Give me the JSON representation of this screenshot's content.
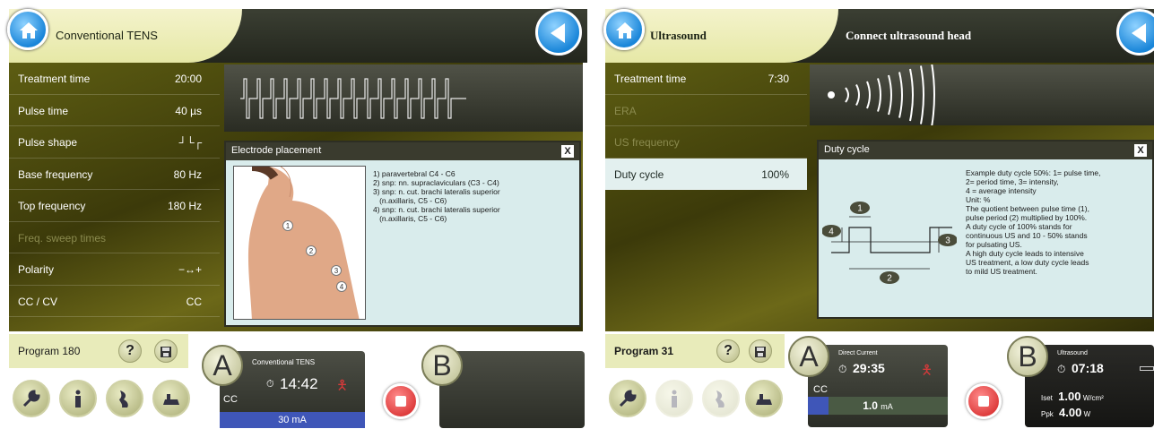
{
  "left": {
    "title": "Conventional TENS",
    "params": [
      {
        "label": "Treatment time",
        "value": "20:00",
        "state": "normal"
      },
      {
        "label": "Pulse time",
        "value": "40 µs",
        "state": "normal"
      },
      {
        "label": "Pulse shape",
        "value": "┘└┌",
        "state": "normal"
      },
      {
        "label": "Base frequency",
        "value": "80 Hz",
        "state": "normal"
      },
      {
        "label": "Top frequency",
        "value": "180 Hz",
        "state": "normal"
      },
      {
        "label": "Freq. sweep times",
        "value": "",
        "state": "dim"
      },
      {
        "label": "Polarity",
        "value": "−↔+",
        "state": "normal"
      },
      {
        "label": "CC / CV",
        "value": "CC",
        "state": "normal"
      }
    ],
    "popup": {
      "title": "Electrode placement",
      "close": "X",
      "lines": [
        "1) paravertebral C4 - C6",
        "2) snp: nn. supraclaviculars (C3 - C4)",
        "3) snp: n. cut. brachi lateralis superior",
        "   (n.axillaris, C5 - C6)",
        "4) snp: n. cut. brachi lateralis superior",
        "   (n.axillaris, C5 - C6)"
      ],
      "markers": [
        "1",
        "2",
        "3",
        "4"
      ]
    },
    "program": "Program 180",
    "help": "?",
    "channel_a": {
      "letter": "A",
      "mode": "Conventional TENS",
      "time": "14:42",
      "type": "CC",
      "intensity": "30 mA",
      "intensity_fraction": 1.0
    },
    "channel_b": {
      "letter": "B"
    }
  },
  "right": {
    "title": "Ultrasound",
    "subtitle": "Connect ultrasound head",
    "params": [
      {
        "label": "Treatment time",
        "value": "7:30",
        "state": "normal"
      },
      {
        "label": "ERA",
        "value": "",
        "state": "dim"
      },
      {
        "label": "US frequency",
        "value": "",
        "state": "dim"
      },
      {
        "label": "Duty cycle",
        "value": "100%",
        "state": "selected"
      }
    ],
    "popup": {
      "title": "Duty cycle",
      "close": "X",
      "lines": [
        "Example duty cycle 50%: 1= pulse time,",
        "2= period time, 3= intensity,",
        "4 = average intensity",
        "Unit: %",
        "The quotient between pulse time (1),",
        "pulse period (2) multiplied by 100%.",
        "A duty cycle of 100% stands for",
        "continuous US and 10 - 50% stands",
        "for pulsating US.",
        "A high duty cycle leads to intensive",
        "US treatment, a low duty cycle leads",
        "to mild US treatment."
      ],
      "markers": [
        "1",
        "2",
        "3",
        "4"
      ]
    },
    "program": "Program 31",
    "help": "?",
    "channel_a": {
      "letter": "A",
      "mode": "Direct Current",
      "time": "29:35",
      "type": "CC",
      "intensity_value": "1.0",
      "intensity_unit": "mA",
      "intensity_fraction": 0.15
    },
    "channel_b": {
      "letter": "B",
      "mode": "Ultrasound",
      "time": "07:18",
      "iset_label": "Iset",
      "iset_value": "1.00",
      "iset_unit": "W/cm²",
      "ppk_label": "Ppk",
      "ppk_value": "4.00",
      "ppk_unit": "W"
    }
  },
  "colors": {
    "accent_blue": "#1a86d9",
    "header_tab": "#e6e8a6",
    "olive_bg": "#4e4c10",
    "stop_red": "#d11e1e",
    "intensity_bar": "#3f56b8"
  }
}
